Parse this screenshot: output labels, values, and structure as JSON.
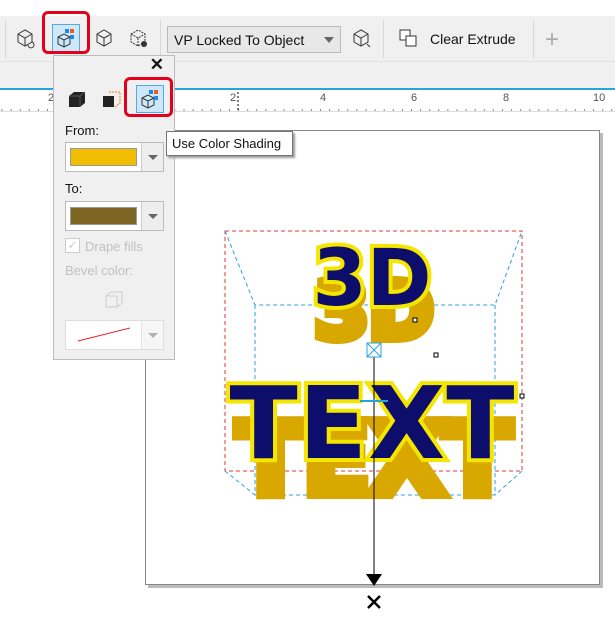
{
  "toolbar": {
    "items": [
      {
        "icon": "extrude-rotation-icon"
      },
      {
        "icon": "extrude-color-icon",
        "selected": true
      },
      {
        "icon": "extrude-bevel-icon"
      },
      {
        "icon": "extrude-lighting-icon"
      }
    ],
    "vanishing_point": "VP Locked To Object",
    "copy_vp_icon": "copy-vanishing-point-icon",
    "clear_extrude": "Clear Extrude",
    "add": "+"
  },
  "ruler": {
    "labels": [
      "2",
      "2",
      "4",
      "6",
      "8",
      "10"
    ]
  },
  "color_popup": {
    "close": "✕",
    "modes": [
      "use-object-fill-icon",
      "use-solid-color-icon",
      "use-color-shading-icon"
    ],
    "from_label": "From:",
    "from_color": "#f0bd00",
    "to_label": "To:",
    "to_color": "#7f6523",
    "drape_fills": "Drape fills",
    "drape_checked": true,
    "bevel_color_label": "Bevel color:",
    "bevel_color": "#e8202a"
  },
  "tooltip": "Use Color Shading",
  "canvas": {
    "line1": "3D",
    "line2": "TEXT",
    "text_fill": "#0d0d6b",
    "outline": "#f5e600",
    "extrude": "#e8b800"
  }
}
